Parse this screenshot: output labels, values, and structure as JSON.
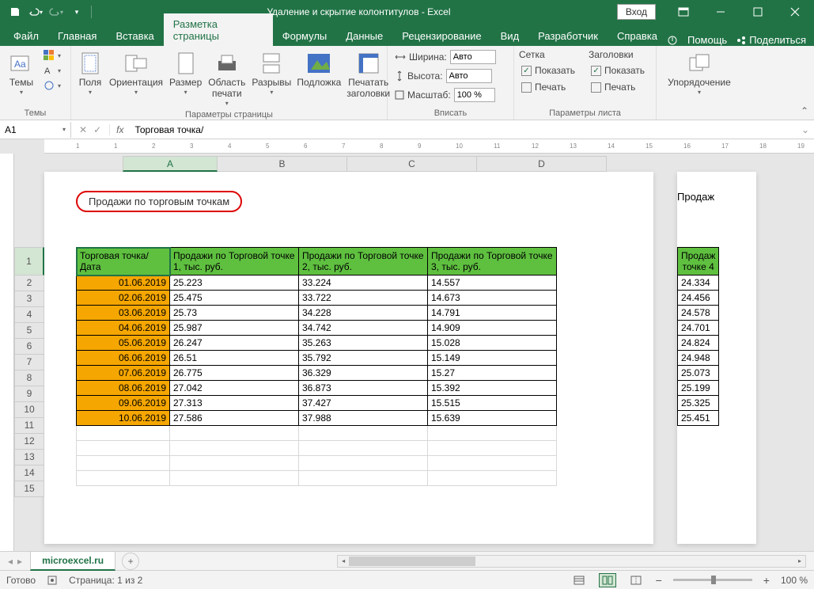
{
  "title": "Удаление и скрытие колонтитулов  -  Excel",
  "signin": "Вход",
  "tabs": [
    "Файл",
    "Главная",
    "Вставка",
    "Разметка страницы",
    "Формулы",
    "Данные",
    "Рецензирование",
    "Вид",
    "Разработчик",
    "Справка"
  ],
  "active_tab_index": 3,
  "help": {
    "hint": "Помощь",
    "share": "Поделиться"
  },
  "ribbon": {
    "themes": {
      "label": "Темы",
      "btn": "Темы"
    },
    "page_setup": {
      "label": "Параметры страницы",
      "margins": "Поля",
      "orientation": "Ориентация",
      "size": "Размер",
      "print_area": "Область печати",
      "breaks": "Разрывы",
      "background": "Подложка",
      "print_titles": "Печатать заголовки"
    },
    "scale": {
      "label": "Вписать",
      "width": "Ширина:",
      "height": "Высота:",
      "scale_lbl": "Масштаб:",
      "auto": "Авто",
      "scale_val": "100 %"
    },
    "sheet_options": {
      "label": "Параметры листа",
      "grid": "Сетка",
      "headings": "Заголовки",
      "show": "Показать",
      "print": "Печать"
    },
    "arrange": {
      "label": "",
      "btn": "Упорядочение"
    }
  },
  "name_box": "A1",
  "formula": "Торговая точка/",
  "page_header_text": "Продажи по торговым точкам",
  "page2_header": "Продаж",
  "columns": [
    "A",
    "B",
    "C",
    "D"
  ],
  "row_numbers": [
    1,
    2,
    3,
    4,
    5,
    6,
    7,
    8,
    9,
    10,
    11,
    12,
    13,
    14,
    15
  ],
  "table": {
    "headers": [
      "Торговая точка/ Дата",
      "Продажи по Торговой точке 1, тыс. руб.",
      "Продажи по Торговой точке 2, тыс. руб.",
      "Продажи по Торговой точке 3, тыс. руб."
    ],
    "rows": [
      [
        "01.06.2019",
        "25.223",
        "33.224",
        "14.557"
      ],
      [
        "02.06.2019",
        "25.475",
        "33.722",
        "14.673"
      ],
      [
        "03.06.2019",
        "25.73",
        "34.228",
        "14.791"
      ],
      [
        "04.06.2019",
        "25.987",
        "34.742",
        "14.909"
      ],
      [
        "05.06.2019",
        "26.247",
        "35.263",
        "15.028"
      ],
      [
        "06.06.2019",
        "26.51",
        "35.792",
        "15.149"
      ],
      [
        "07.06.2019",
        "26.775",
        "36.329",
        "15.27"
      ],
      [
        "08.06.2019",
        "27.042",
        "36.873",
        "15.392"
      ],
      [
        "09.06.2019",
        "27.313",
        "37.427",
        "15.515"
      ],
      [
        "10.06.2019",
        "27.586",
        "37.988",
        "15.639"
      ]
    ]
  },
  "table2": {
    "header1": "Продаж",
    "header2": "точке 4",
    "values": [
      "24.334",
      "24.456",
      "24.578",
      "24.701",
      "24.824",
      "24.948",
      "25.073",
      "25.199",
      "25.325",
      "25.451"
    ]
  },
  "sheet_tab": "microexcel.ru",
  "status": {
    "ready": "Готово",
    "page": "Страница: 1 из 2",
    "zoom": "100 %"
  },
  "ruler_ticks": [
    "1",
    "1",
    "2",
    "3",
    "4",
    "5",
    "6",
    "7",
    "8",
    "9",
    "10",
    "11",
    "12",
    "13",
    "14",
    "15",
    "16",
    "17",
    "18",
    "19"
  ]
}
